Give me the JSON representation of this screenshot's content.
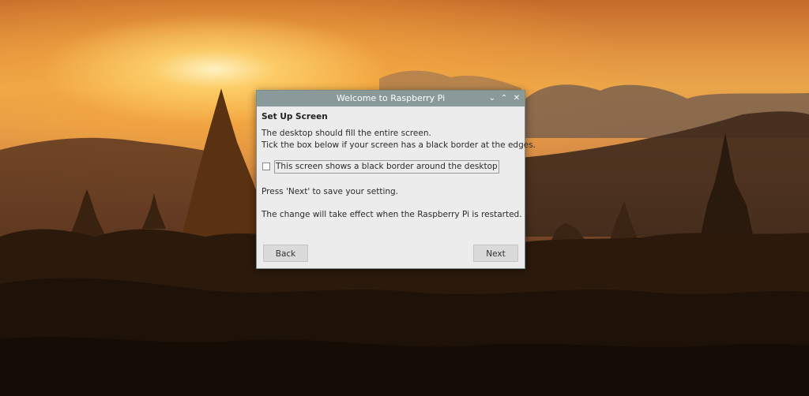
{
  "window": {
    "title": "Welcome to Raspberry Pi",
    "controls": {
      "minimize": "⌄",
      "maximize": "⌃",
      "close": "✕"
    }
  },
  "page": {
    "heading": "Set Up Screen",
    "description_line1": "The desktop should fill the entire screen.",
    "description_line2": "Tick the box below if your screen has a black border at the edges.",
    "checkbox": {
      "label": "This screen shows a black border around the desktop",
      "checked": false
    },
    "hint_save": "Press 'Next' to save your setting.",
    "hint_restart": "The change will take effect when the Raspberry Pi is restarted."
  },
  "buttons": {
    "back": "Back",
    "next": "Next"
  },
  "colors": {
    "titlebar": "#8a9a9a",
    "dialog_bg": "#ececec",
    "button_bg": "#dadada"
  }
}
